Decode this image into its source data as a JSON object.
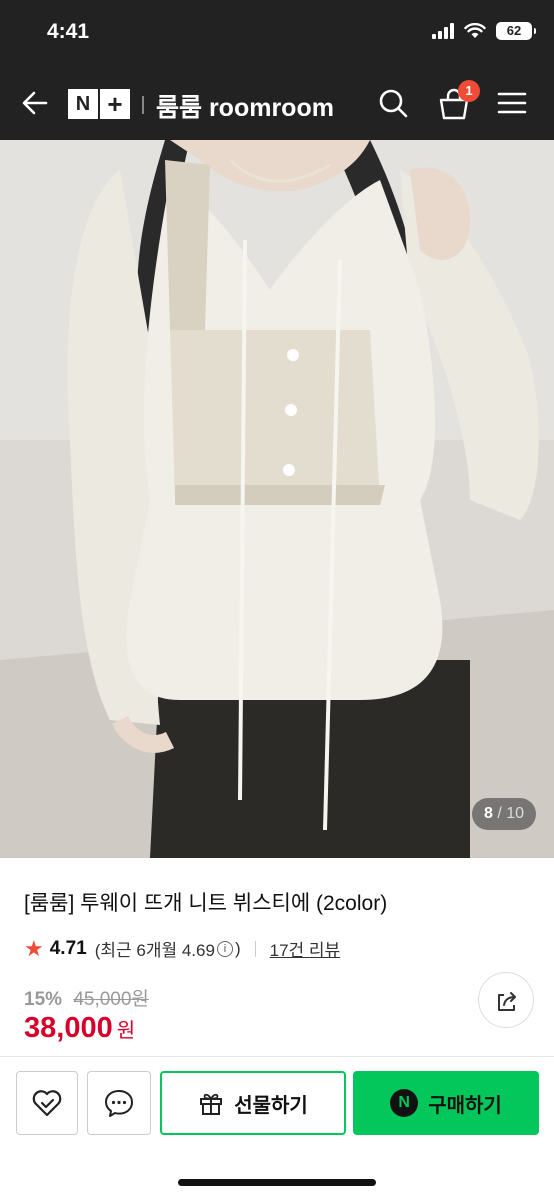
{
  "status_bar": {
    "time": "4:41",
    "battery": "62"
  },
  "nav": {
    "logo_n": "N",
    "logo_plus": "+",
    "title": "룸룸 roomroom",
    "cart_count": "1"
  },
  "image": {
    "current": "8",
    "total": "/ 10"
  },
  "product": {
    "title": "[룸룸] 투웨이 뜨개 니트 뷔스티에 (2color)",
    "rating": "4.71",
    "recent_open": "(최근 6개월 4.69",
    "info_mark": "i",
    "recent_close": ")",
    "review_link": "17건 리뷰",
    "discount": "15%",
    "original_price": "45,000원",
    "sale_price": "38,000",
    "currency": "원"
  },
  "actions": {
    "gift_label": "선물하기",
    "buy_label": "구매하기",
    "npay_mark": "N"
  },
  "colors": {
    "naver_green": "#03c75a",
    "sale_red": "#d6002b",
    "badge_red": "#f04b36",
    "header_dark": "#222222"
  }
}
